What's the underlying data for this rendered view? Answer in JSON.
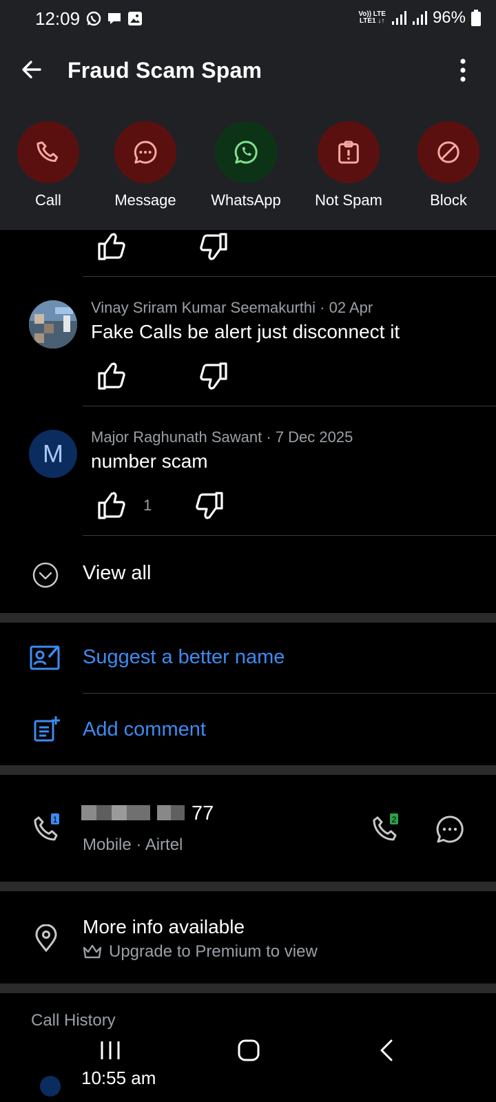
{
  "status": {
    "time": "12:09",
    "network_top": "Vo)) LTE",
    "network_bottom": "LTE1 ↓↑",
    "battery": "96%"
  },
  "header": {
    "title": "Fraud Scam Spam"
  },
  "actions": [
    {
      "label": "Call",
      "icon": "phone-icon"
    },
    {
      "label": "Message",
      "icon": "chat-bubble-icon"
    },
    {
      "label": "WhatsApp",
      "icon": "whatsapp-icon"
    },
    {
      "label": "Not Spam",
      "icon": "report-icon"
    },
    {
      "label": "Block",
      "icon": "block-icon"
    }
  ],
  "comments": [
    {
      "author": "Vinay Sriram Kumar Seemakurthi · 02 Apr",
      "text": "Fake Calls be alert just disconnect it",
      "likes": ""
    },
    {
      "author": "Major Raghunath Sawant · 7 Dec 2025",
      "avatar_letter": "M",
      "text": "number scam",
      "likes": "1"
    }
  ],
  "view_all": "View all",
  "suggest_name": "Suggest a better name",
  "add_comment": "Add comment",
  "phone": {
    "number_suffix": "77",
    "sim1_badge": "1",
    "sim2_badge": "2",
    "type": "Mobile · Airtel"
  },
  "more_info": {
    "title": "More info available",
    "subtitle": "Upgrade to Premium to view"
  },
  "call_history": {
    "heading": "Call History",
    "first_time": "10:55 am"
  },
  "colors": {
    "accent": "#3d8bf2",
    "danger_circle": "#5b1010",
    "whatsapp_circle": "#0d3316",
    "header_bg": "#202125"
  }
}
